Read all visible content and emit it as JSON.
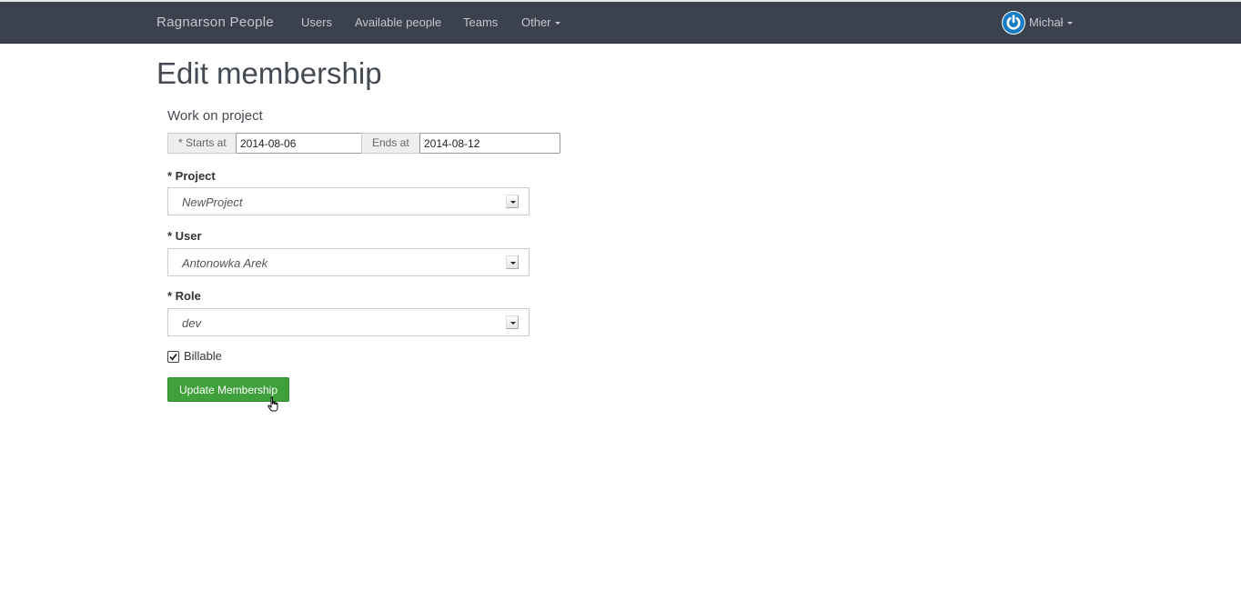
{
  "navbar": {
    "brand": "Ragnarson People",
    "links": [
      {
        "label": "Users"
      },
      {
        "label": "Available people"
      },
      {
        "label": "Teams"
      },
      {
        "label": "Other"
      }
    ],
    "user": {
      "name": "Michał",
      "avatar_icon": "power-logo-icon",
      "avatar_color": "#1a7dc4"
    }
  },
  "page": {
    "title": "Edit membership"
  },
  "form": {
    "legend": "Work on project",
    "starts_at": {
      "label": "* Starts at",
      "value": "2014-08-06"
    },
    "ends_at": {
      "label": "Ends at",
      "value": "2014-08-12"
    },
    "project": {
      "label": "* Project",
      "value": "NewProject"
    },
    "user": {
      "label": "* User",
      "value": "Antonowka Arek"
    },
    "role": {
      "label": "* Role",
      "value": "dev"
    },
    "billable": {
      "label": "Billable",
      "checked": true
    },
    "submit_label": "Update Membership"
  },
  "colors": {
    "navbar_bg": "#3b414d",
    "submit_bg": "#3fa03c"
  }
}
